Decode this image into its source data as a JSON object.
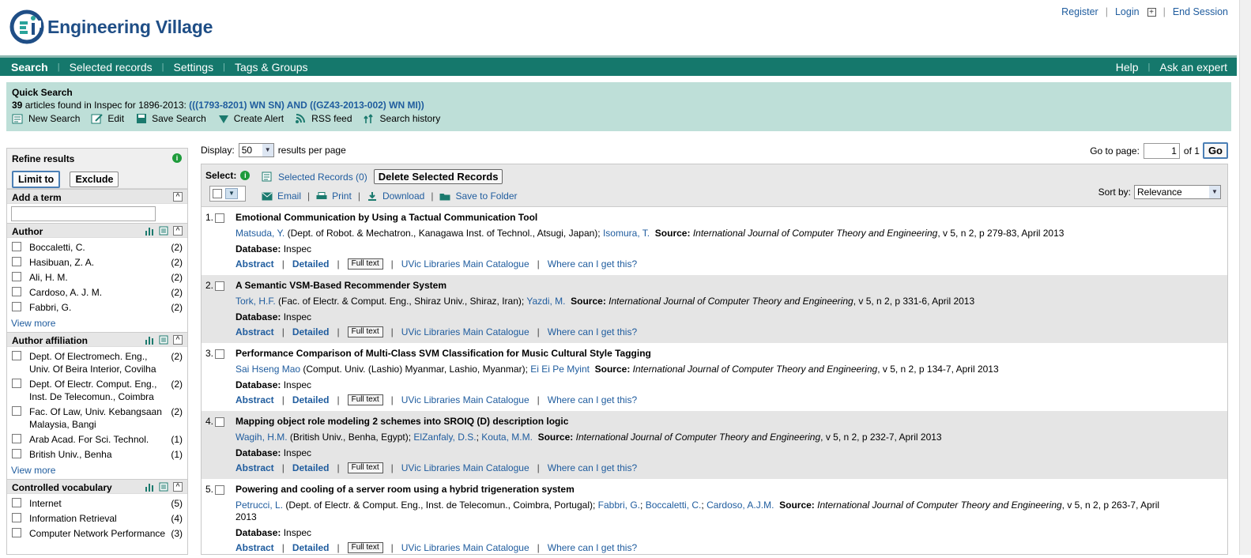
{
  "header": {
    "logo_text": "Engineering Village",
    "register": "Register",
    "login": "Login",
    "end_session": "End Session"
  },
  "nav": {
    "left": [
      "Search",
      "Selected records",
      "Settings",
      "Tags & Groups"
    ],
    "right": [
      "Help",
      "Ask an expert"
    ]
  },
  "quick_search": {
    "title": "Quick Search",
    "count": "39",
    "count_text": " articles found in Inspec for 1896-2013: ",
    "query": "(((1793-8201) WN SN) AND ((GZ43-2013-002) WN MI))",
    "tools": [
      {
        "label": "New Search",
        "icon": "new-search-icon"
      },
      {
        "label": "Edit",
        "icon": "edit-icon"
      },
      {
        "label": "Save Search",
        "icon": "save-icon"
      },
      {
        "label": "Create Alert",
        "icon": "alert-icon"
      },
      {
        "label": "RSS feed",
        "icon": "rss-icon"
      },
      {
        "label": "Search history",
        "icon": "history-icon"
      }
    ]
  },
  "sidebar": {
    "refine_title": "Refine results",
    "limit_to": "Limit to",
    "exclude": "Exclude",
    "add_term": "Add a term",
    "view_more": "View more",
    "author": {
      "title": "Author",
      "items": [
        {
          "label": "Boccaletti, C.",
          "count": "(2)"
        },
        {
          "label": "Hasibuan, Z. A.",
          "count": "(2)"
        },
        {
          "label": "Ali, H. M.",
          "count": "(2)"
        },
        {
          "label": "Cardoso, A. J. M.",
          "count": "(2)"
        },
        {
          "label": "Fabbri, G.",
          "count": "(2)"
        }
      ]
    },
    "affiliation": {
      "title": "Author affiliation",
      "items": [
        {
          "label": "Dept. Of Electromech. Eng., Univ. Of Beira Interior, Covilha",
          "count": "(2)"
        },
        {
          "label": "Dept. Of Electr. Comput. Eng., Inst. De Telecomun., Coimbra",
          "count": "(2)"
        },
        {
          "label": "Fac. Of Law, Univ. Kebangsaan Malaysia, Bangi",
          "count": "(2)"
        },
        {
          "label": "Arab Acad. For Sci. Technol.",
          "count": "(1)"
        },
        {
          "label": "British Univ., Benha",
          "count": "(1)"
        }
      ]
    },
    "vocab": {
      "title": "Controlled vocabulary",
      "items": [
        {
          "label": "Internet",
          "count": "(5)"
        },
        {
          "label": "Information Retrieval",
          "count": "(4)"
        },
        {
          "label": "Computer Network Performance",
          "count": "(3)"
        }
      ]
    }
  },
  "results_bar": {
    "display_label": "Display:",
    "per_page": "50",
    "per_page_suffix": "results per page",
    "goto_label": "Go to page:",
    "page": "1",
    "of_text": "of 1",
    "go": "Go"
  },
  "toolbar": {
    "select_label": "Select:",
    "selected_records": "Selected Records (0)",
    "delete_selected": "Delete Selected Records",
    "email": "Email",
    "print": "Print",
    "download": "Download",
    "save_folder": "Save to Folder",
    "sort_by": "Sort by:",
    "sort_value": "Relevance"
  },
  "record_links": {
    "abstract": "Abstract",
    "detailed": "Detailed",
    "full_text": "Full text",
    "catalogue": "UVic Libraries Main Catalogue",
    "where": "Where can I get this?",
    "database_label": "Database:",
    "source_label": "Source:"
  },
  "records": [
    {
      "num": "1.",
      "title": "Emotional Communication by Using a Tactual Communication Tool",
      "a1": "Matsuda, Y.",
      "aff1": " (Dept. of Robot. & Mechatron., Kanagawa Inst. of Technol., Atsugi, Japan); ",
      "a2": "Isomura, T.",
      "a3": "",
      "a4": "",
      "journal": "International Journal of Computer Theory and Engineering",
      "src": ", v 5, n 2, p 279-83, April 2013",
      "db": "Inspec"
    },
    {
      "num": "2.",
      "title": "A Semantic VSM-Based Recommender System",
      "a1": "Tork, H.F.",
      "aff1": " (Fac. of Electr. & Comput. Eng., Shiraz Univ., Shiraz, Iran); ",
      "a2": "Yazdi, M.",
      "a3": "",
      "a4": "",
      "journal": "International Journal of Computer Theory and Engineering",
      "src": ", v 5, n 2, p 331-6, April 2013",
      "db": "Inspec"
    },
    {
      "num": "3.",
      "title": "Performance Comparison of Multi-Class SVM Classification for Music Cultural Style Tagging",
      "a1": "Sai Hseng Mao",
      "aff1": " (Comput. Univ. (Lashio) Myanmar, Lashio, Myanmar); ",
      "a2": "Ei Ei Pe Myint",
      "a3": "",
      "a4": "",
      "journal": "International Journal of Computer Theory and Engineering",
      "src": ", v 5, n 2, p 134-7, April 2013",
      "db": "Inspec"
    },
    {
      "num": "4.",
      "title": "Mapping object role modeling 2 schemes into SROIQ (D) description logic",
      "a1": "Wagih, H.M.",
      "aff1": " (British Univ., Benha, Egypt); ",
      "a2": "ElZanfaly, D.S.",
      "a3": "Kouta, M.M.",
      "a4": "",
      "journal": "International Journal of Computer Theory and Engineering",
      "src": ", v 5, n 2, p 232-7, April 2013",
      "db": "Inspec"
    },
    {
      "num": "5.",
      "title": "Powering and cooling of a server room using a hybrid trigeneration system",
      "a1": "Petrucci, L.",
      "aff1": " (Dept. of Electr. & Comput. Eng., Inst. de Telecomun., Coimbra, Portugal); ",
      "a2": "Fabbri, G.",
      "a3": "Boccaletti, C.",
      "a4": "Cardoso, A.J.M.",
      "journal": "International Journal of Computer Theory and Engineering",
      "src": ", v 5, n 2, p 263-7, April 2013",
      "db": "Inspec"
    }
  ]
}
